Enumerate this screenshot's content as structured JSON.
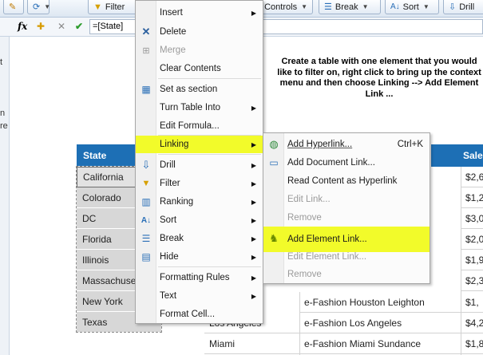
{
  "toolbar": {
    "filter_label": "Filter",
    "controls_label": "Controls",
    "break_label": "Break",
    "sort_label": "Sort",
    "drill_label": "Drill"
  },
  "formula": {
    "fx_label": "fx",
    "value": "=[State]"
  },
  "gutter": {
    "text_a": "t",
    "text_b": "n",
    "text_c": "re"
  },
  "annotation": "Create a table with one element that you would like to filter on, right click to bring up the context menu and then choose Linking --> Add Element Link ...",
  "table": {
    "state_header": "State",
    "sales_header": "Sale",
    "states": [
      "California",
      "Colorado",
      "DC",
      "Florida",
      "Illinois",
      "Massachuse",
      "New York",
      "Texas"
    ],
    "rows": [
      {
        "city": "",
        "store": "e-Fashion Houston Leighton",
        "sales": "$1,"
      },
      {
        "city": "Los Angeles",
        "store": "e-Fashion Los Angeles",
        "sales": "$4,2"
      },
      {
        "city": "Miami",
        "store": "e-Fashion Miami Sundance",
        "sales": "$1,8"
      }
    ],
    "sales_visible": [
      "$2,6",
      "$1,2",
      "$3,0",
      "$2,0",
      "$1,9",
      "$2,3"
    ]
  },
  "context_menu": [
    {
      "label": "Insert",
      "submenu": true,
      "enabled": true
    },
    {
      "label": "Delete",
      "submenu": false,
      "enabled": true
    },
    {
      "label": "Merge",
      "submenu": false,
      "enabled": false
    },
    {
      "label": "Clear Contents",
      "submenu": false,
      "enabled": true
    },
    {
      "label": "Set as section",
      "submenu": false,
      "enabled": true
    },
    {
      "label": "Turn Table Into",
      "submenu": true,
      "enabled": true
    },
    {
      "label": "Edit Formula...",
      "submenu": false,
      "enabled": true
    },
    {
      "label": "Linking",
      "submenu": true,
      "enabled": true,
      "highlighted": true
    },
    {
      "label": "Drill",
      "submenu": true,
      "enabled": true
    },
    {
      "label": "Filter",
      "submenu": true,
      "enabled": true
    },
    {
      "label": "Ranking",
      "submenu": true,
      "enabled": true
    },
    {
      "label": "Sort",
      "submenu": true,
      "enabled": true
    },
    {
      "label": "Break",
      "submenu": true,
      "enabled": true
    },
    {
      "label": "Hide",
      "submenu": true,
      "enabled": true
    },
    {
      "label": "Formatting Rules",
      "submenu": true,
      "enabled": true
    },
    {
      "label": "Text",
      "submenu": true,
      "enabled": true
    },
    {
      "label": "Format Cell...",
      "submenu": false,
      "enabled": true
    }
  ],
  "linking_submenu": [
    {
      "label": "Add Hyperlink...",
      "shortcut": "Ctrl+K",
      "enabled": true
    },
    {
      "label": "Add Document Link...",
      "enabled": true
    },
    {
      "label": "Read Content as Hyperlink",
      "enabled": true
    },
    {
      "label": "Edit Link...",
      "enabled": false
    },
    {
      "label": "Remove",
      "enabled": false
    },
    {
      "label": "Add Element Link...",
      "enabled": true,
      "highlighted": true
    },
    {
      "label": "Edit Element Link...",
      "enabled": false
    },
    {
      "label": "Remove",
      "enabled": false
    }
  ],
  "colors": {
    "header_blue": "#1d6fb5",
    "highlight_yellow": "#f2fb2a",
    "state_cell_gray": "#d7d7d7"
  }
}
